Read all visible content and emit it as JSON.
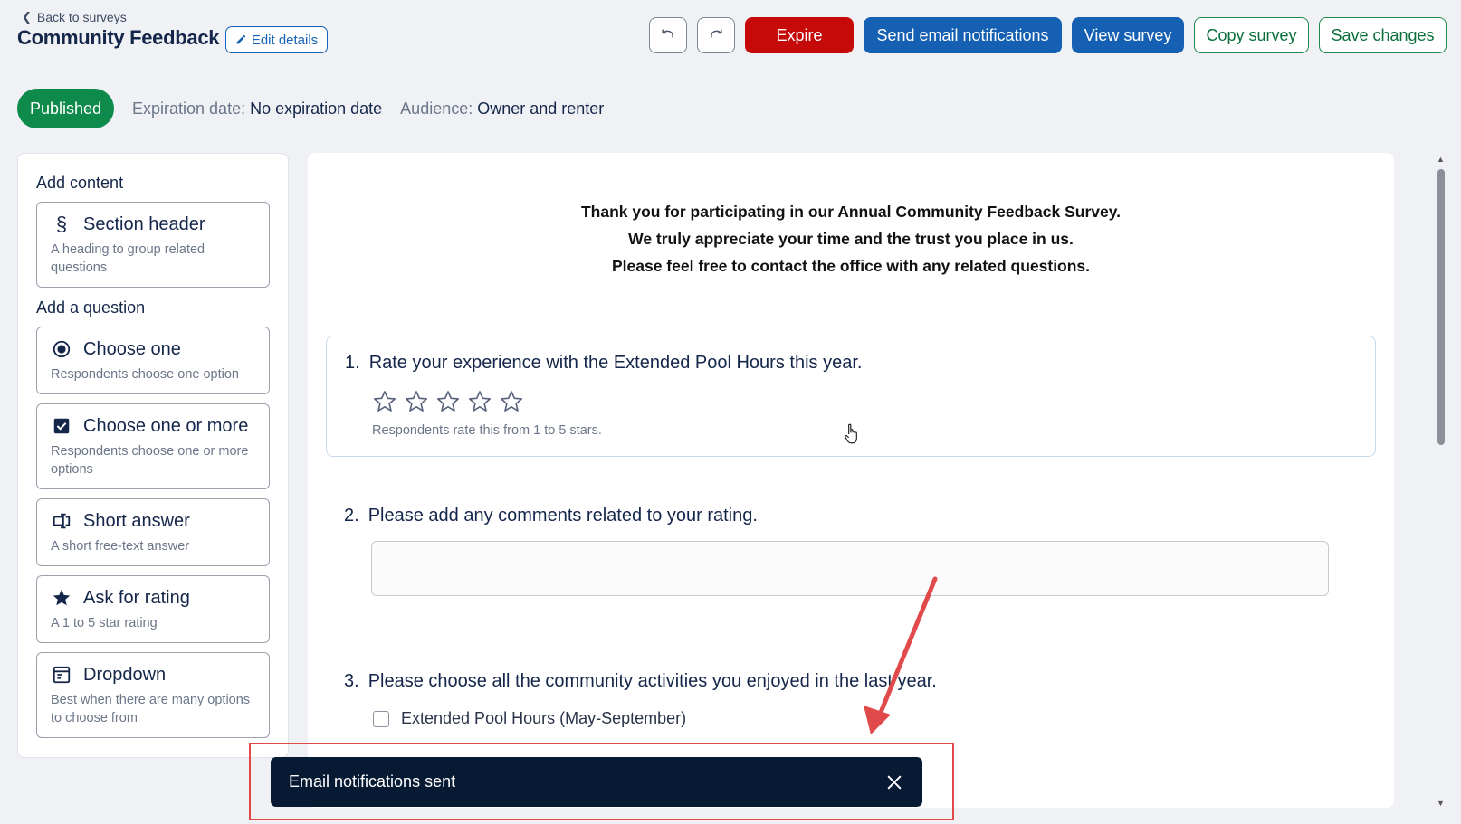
{
  "header": {
    "back_label": "Back to surveys",
    "title": "Community Feedback",
    "edit_label": "Edit details"
  },
  "toolbar": {
    "undo_icon": "undo-icon",
    "redo_icon": "redo-icon",
    "expire_label": "Expire",
    "send_email_label": "Send email notifications",
    "view_label": "View survey",
    "copy_label": "Copy survey",
    "save_label": "Save changes"
  },
  "status": {
    "badge": "Published",
    "expiration_label": "Expiration date:",
    "expiration_value": "No expiration date",
    "audience_label": "Audience:",
    "audience_value": "Owner and renter"
  },
  "sidebar": {
    "content_heading": "Add content",
    "question_heading": "Add a question",
    "content_items": [
      {
        "title": "Section header",
        "desc": "A heading to group related questions",
        "icon": "section-icon"
      }
    ],
    "question_items": [
      {
        "title": "Choose one",
        "desc": "Respondents choose one option",
        "icon": "radio-icon"
      },
      {
        "title": "Choose one or more",
        "desc": "Respondents choose one or more options",
        "icon": "checkbox-icon"
      },
      {
        "title": "Short answer",
        "desc": "A short free-text answer",
        "icon": "text-field-icon"
      },
      {
        "title": "Ask for rating",
        "desc": "A 1 to 5 star rating",
        "icon": "star-icon"
      },
      {
        "title": "Dropdown",
        "desc": "Best when there are many options to choose from",
        "icon": "dropdown-icon"
      }
    ]
  },
  "survey": {
    "intro_lines": [
      "Thank you for participating in our Annual Community Feedback Survey.",
      "We truly appreciate your time and the trust you place in us.",
      "Please feel free to contact the office with any related questions."
    ],
    "questions": [
      {
        "number": "1.",
        "text": "Rate your experience with the Extended Pool Hours this year.",
        "hint": "Respondents rate this from 1 to 5 stars.",
        "stars": 5
      },
      {
        "number": "2.",
        "text": "Please add any comments related to your rating."
      },
      {
        "number": "3.",
        "text": "Please choose all the community activities you enjoyed in the last year.",
        "options": [
          "Extended Pool Hours (May-September)"
        ]
      }
    ]
  },
  "toast": {
    "message": "Email notifications sent",
    "close_icon": "close-icon"
  },
  "colors": {
    "danger": "#c60a0a",
    "primary": "#1560b2",
    "success": "#0e8a4a",
    "toast_bg": "#061a33",
    "annotation": "#e04a4a"
  }
}
